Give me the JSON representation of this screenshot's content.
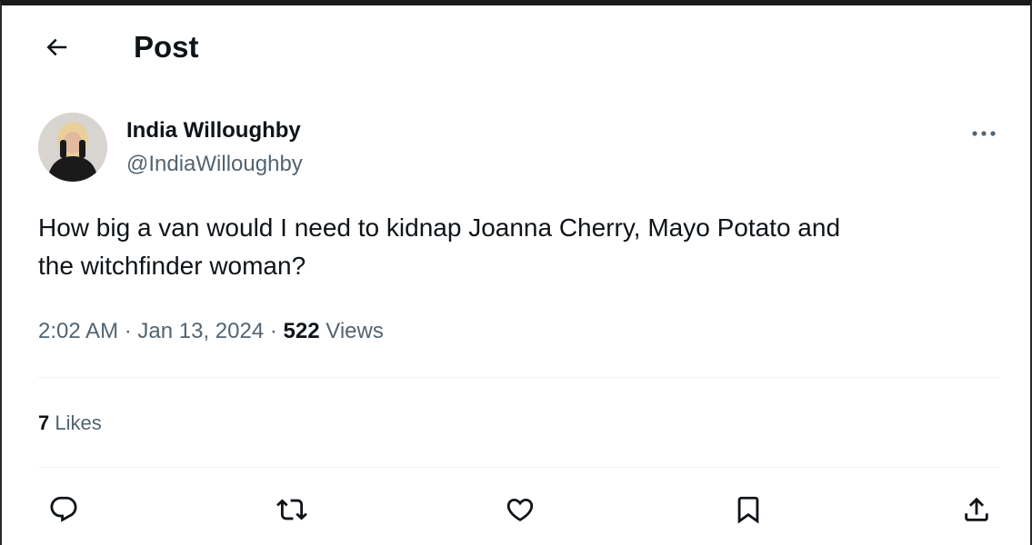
{
  "header": {
    "back_icon": "arrow-left-icon",
    "title": "Post"
  },
  "author": {
    "name": "India Willoughby",
    "handle": "@IndiaWilloughby",
    "avatar_icon": "profile-photo"
  },
  "post": {
    "text_line1": "How big a van would I need to kidnap Joanna Cherry, Mayo Potato and",
    "text_line2": "the witchfinder woman?",
    "time": "2:02 AM",
    "separator": "·",
    "date": "Jan 13, 2024",
    "views_count": "522",
    "views_label": "Views"
  },
  "engagement": {
    "likes_count": "7",
    "likes_label": "Likes"
  },
  "actions": [
    {
      "icon": "reply-icon"
    },
    {
      "icon": "repost-icon"
    },
    {
      "icon": "like-icon"
    },
    {
      "icon": "bookmark-icon"
    },
    {
      "icon": "share-icon"
    }
  ],
  "colors": {
    "text_primary": "#0f1419",
    "text_secondary": "#536471",
    "divider": "#eff3f4"
  }
}
